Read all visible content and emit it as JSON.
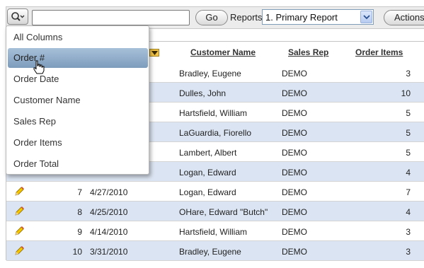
{
  "toolbar": {
    "search_value": "",
    "go_label": "Go",
    "reports_label": "Reports",
    "reports_selected": "1. Primary Report",
    "actions_label": "Actions"
  },
  "table": {
    "headers": {
      "customer_name": "Customer Name",
      "sales_rep": "Sales Rep",
      "order_items": "Order Items"
    },
    "rows": [
      {
        "order": "",
        "date": "",
        "customer": "Bradley, Eugene",
        "rep": "DEMO",
        "items": "3"
      },
      {
        "order": "",
        "date": "",
        "customer": "Dulles, John",
        "rep": "DEMO",
        "items": "10"
      },
      {
        "order": "",
        "date": "",
        "customer": "Hartsfield, William",
        "rep": "DEMO",
        "items": "5"
      },
      {
        "order": "",
        "date": "",
        "customer": "LaGuardia, Fiorello",
        "rep": "DEMO",
        "items": "5"
      },
      {
        "order": "",
        "date": "",
        "customer": "Lambert, Albert",
        "rep": "DEMO",
        "items": "5"
      },
      {
        "order": "",
        "date": "",
        "customer": "Logan, Edward",
        "rep": "DEMO",
        "items": "4"
      },
      {
        "order": "7",
        "date": "4/27/2010",
        "customer": "Logan, Edward",
        "rep": "DEMO",
        "items": "7"
      },
      {
        "order": "8",
        "date": "4/25/2010",
        "customer": "OHare, Edward \"Butch\"",
        "rep": "DEMO",
        "items": "4"
      },
      {
        "order": "9",
        "date": "4/14/2010",
        "customer": "Hartsfield, William",
        "rep": "DEMO",
        "items": "3"
      },
      {
        "order": "10",
        "date": "3/31/2010",
        "customer": "Bradley, Eugene",
        "rep": "DEMO",
        "items": "3"
      }
    ]
  },
  "column_menu": {
    "items": [
      "All Columns",
      "Order #",
      "Order Date",
      "Customer Name",
      "Sales Rep",
      "Order Items",
      "Order Total"
    ],
    "highlighted": "Order #"
  },
  "icons": {
    "search_opener": "magnifier-dropdown-icon",
    "edit": "pencil-icon",
    "sort": "sort-desc-icon",
    "cursor": "hand-pointer-icon"
  },
  "colors": {
    "row_alt": "#dbe4f2",
    "menu_highlight": "#8fabc9",
    "sort_badge": "#f3c54a"
  }
}
